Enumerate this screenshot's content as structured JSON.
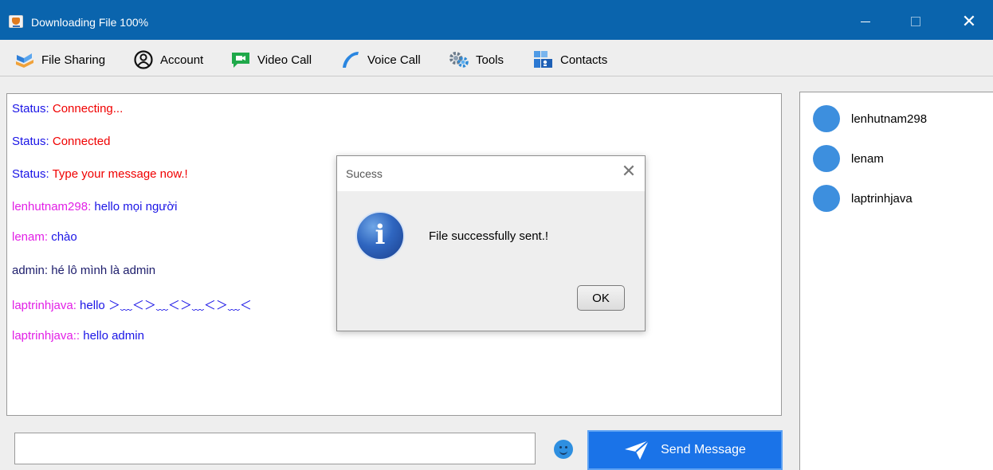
{
  "window": {
    "title": "Downloading File  100%",
    "close_glyph": "✕"
  },
  "menu": [
    {
      "label": "File Sharing",
      "icon": "file-sharing-icon"
    },
    {
      "label": "Account",
      "icon": "account-icon"
    },
    {
      "label": "Video Call",
      "icon": "video-call-icon"
    },
    {
      "label": "Voice Call",
      "icon": "voice-call-icon"
    },
    {
      "label": "Tools",
      "icon": "tools-icon"
    },
    {
      "label": "Contacts",
      "icon": "contacts-icon"
    }
  ],
  "messages": [
    {
      "sender": "Status:",
      "text": " Connecting..."
    },
    {
      "sender": "Status:",
      "text": " Connected"
    },
    {
      "sender": "Status:",
      "text": " Type your message now.!"
    },
    {
      "sender": "lenhutnam298:",
      "text": " hello mọi người"
    },
    {
      "sender": "lenam:",
      "text": " chào"
    },
    {
      "sender": "admin:",
      "text": " hé lô mình là admin"
    },
    {
      "sender": "laptrinhjava:",
      "text": " hello ＞﹏＜＞﹏＜＞﹏＜＞﹏＜"
    },
    {
      "sender": "laptrinhjava::",
      "text": " hello admin"
    }
  ],
  "input": {
    "value": "",
    "placeholder": ""
  },
  "send_button": {
    "label": "Send Message"
  },
  "users": [
    {
      "name": "lenhutnam298"
    },
    {
      "name": "lenam"
    },
    {
      "name": "laptrinhjava"
    }
  ],
  "dialog": {
    "title": "Sucess",
    "close_glyph": "✕",
    "icon_glyph": "i",
    "message": "File successfully sent.!",
    "ok_label": "OK"
  },
  "colors": {
    "titlebar": "#0a64ad",
    "status_label": "#1a14e6",
    "status_text": "#f00000",
    "user_label": "#e21fe6",
    "message_text": "#1a14e6",
    "send_button": "#1a73e8",
    "user_dot": "#3d8fde"
  }
}
